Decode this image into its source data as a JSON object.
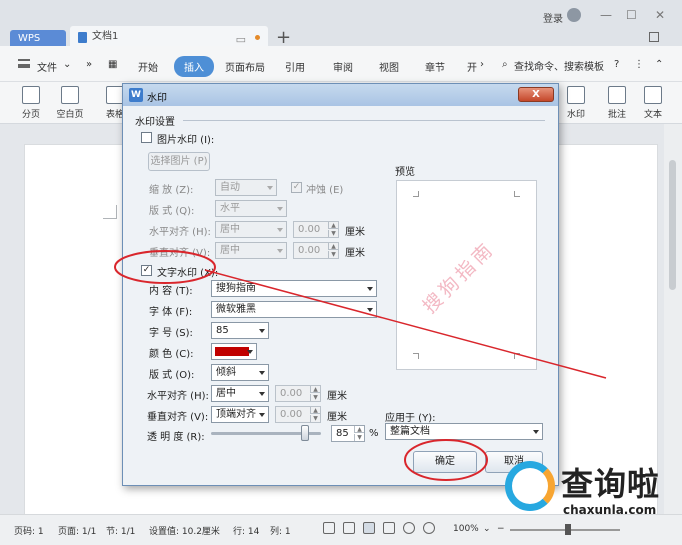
{
  "titlebar": {
    "wps_tab": "WPS",
    "doc_tab": "文档1",
    "login": "登录"
  },
  "menu": {
    "file": "文件",
    "more": "»",
    "items": [
      "开始",
      "插入",
      "页面布局",
      "引用",
      "审阅",
      "视图",
      "章节",
      "开"
    ],
    "active_index": 1,
    "search": "查找命令、搜索模板"
  },
  "ribbon": {
    "left": [
      "分页",
      "空白页",
      "表格"
    ],
    "right": [
      "水印",
      "批注",
      "文本"
    ]
  },
  "dialog": {
    "title": "水印",
    "close": "X",
    "section": "水印设置",
    "picture": {
      "checkbox_label": "图片水印 (I):",
      "checked": false,
      "select_btn": "选择图片 (P)",
      "scale_label": "缩 放 (Z):",
      "scale_value": "自动",
      "washout_label": "冲蚀 (E)",
      "washout_checked": true,
      "layout_label": "版 式 (Q):",
      "layout_value": "水平",
      "halign_label": "水平对齐 (H):",
      "halign_value": "居中",
      "halign_num": "0.00",
      "valign_label": "垂直对齐 (V):",
      "valign_value": "居中",
      "valign_num": "0.00",
      "unit": "厘米"
    },
    "text": {
      "checkbox_label": "文字水印 (X):",
      "checked": true,
      "content_label": "内 容 (T):",
      "content_value": "搜狗指南",
      "font_label": "字 体 (F):",
      "font_value": "微软雅黑",
      "size_label": "字 号 (S):",
      "size_value": "85",
      "color_label": "颜 色 (C):",
      "color_value": "#c00000",
      "layout_label": "版 式 (O):",
      "layout_value": "倾斜",
      "halign_label": "水平对齐 (H):",
      "halign_value": "居中",
      "halign_num": "0.00",
      "valign_label": "垂直对齐 (V):",
      "valign_value": "顶端对齐",
      "valign_num": "0.00",
      "unit": "厘米",
      "transparency_label": "透 明 度 (R):",
      "transparency_value": "85",
      "transparency_unit": "%"
    },
    "preview_label": "预览",
    "preview_text": "搜狗指南",
    "apply_label": "应用于 (Y):",
    "apply_value": "整篇文档",
    "ok": "确定",
    "cancel": "取消"
  },
  "status": {
    "page": "页码: 1",
    "pages": "页面: 1/1",
    "section": "节: 1/1",
    "setting": "设置值: 10.2厘米",
    "row": "行: 14",
    "col": "列: 1",
    "zoom": "100%"
  },
  "brand": {
    "name": "查询啦",
    "url": "chaxunla.com"
  },
  "colors": {
    "accent": "#4e8fd6",
    "annotation_red": "#d9262c",
    "watermark_pink": "#f3b9c4"
  }
}
